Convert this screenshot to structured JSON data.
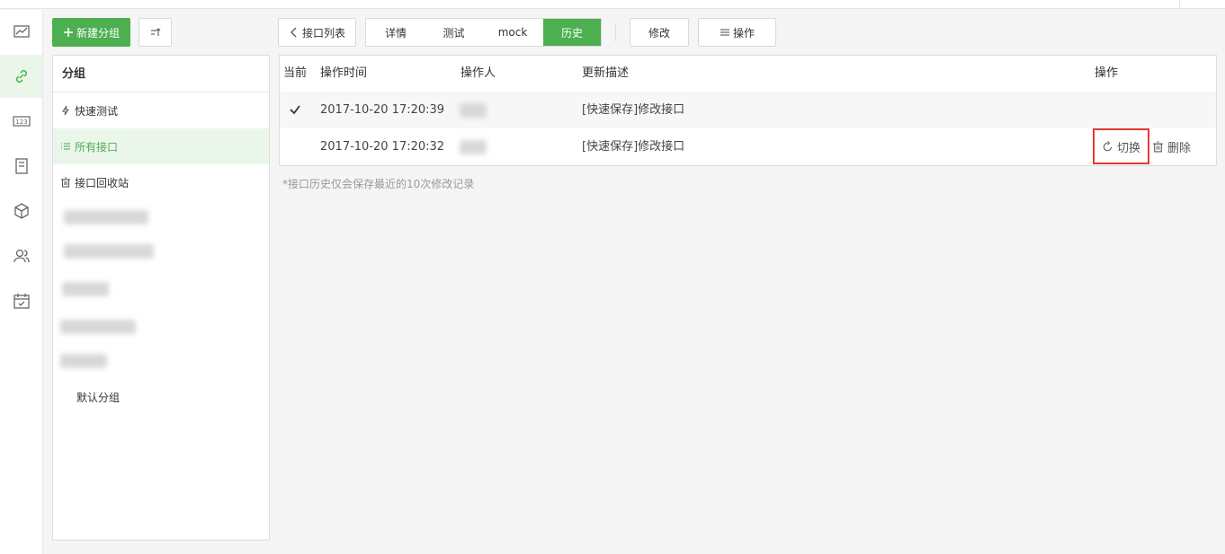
{
  "toolbar": {
    "new_group_label": "新建分组",
    "back_label": "接口列表",
    "tabs": [
      {
        "label": "详情",
        "active": false
      },
      {
        "label": "测试",
        "active": false
      },
      {
        "label": "mock",
        "active": false
      },
      {
        "label": "历史",
        "active": true
      }
    ],
    "edit_label": "修改",
    "actions_label": "操作"
  },
  "rail": {
    "items": [
      "chart-icon",
      "link-icon",
      "number-icon",
      "document-icon",
      "cube-icon",
      "users-icon",
      "calendar-icon"
    ],
    "active_index": 1
  },
  "groups": {
    "title": "分组",
    "items": [
      {
        "label": "快速测试",
        "icon": "lightning-icon"
      },
      {
        "label": "所有接口",
        "icon": "list-icon",
        "active": true
      },
      {
        "label": "接口回收站",
        "icon": "trash-icon"
      }
    ],
    "default_group": "默认分组"
  },
  "history": {
    "columns": [
      "当前",
      "操作时间",
      "操作人",
      "更新描述",
      "操作"
    ],
    "rows": [
      {
        "current": true,
        "time": "2017-10-20 17:20:39",
        "description": "[快速保存]修改接口"
      },
      {
        "current": false,
        "time": "2017-10-20 17:20:32",
        "description": "[快速保存]修改接口",
        "switch_label": "切换",
        "delete_label": "删除"
      }
    ],
    "note": "*接口历史仅会保存最近的10次修改记录"
  },
  "colors": {
    "accent": "#4caf50",
    "highlight": "#e53935"
  }
}
